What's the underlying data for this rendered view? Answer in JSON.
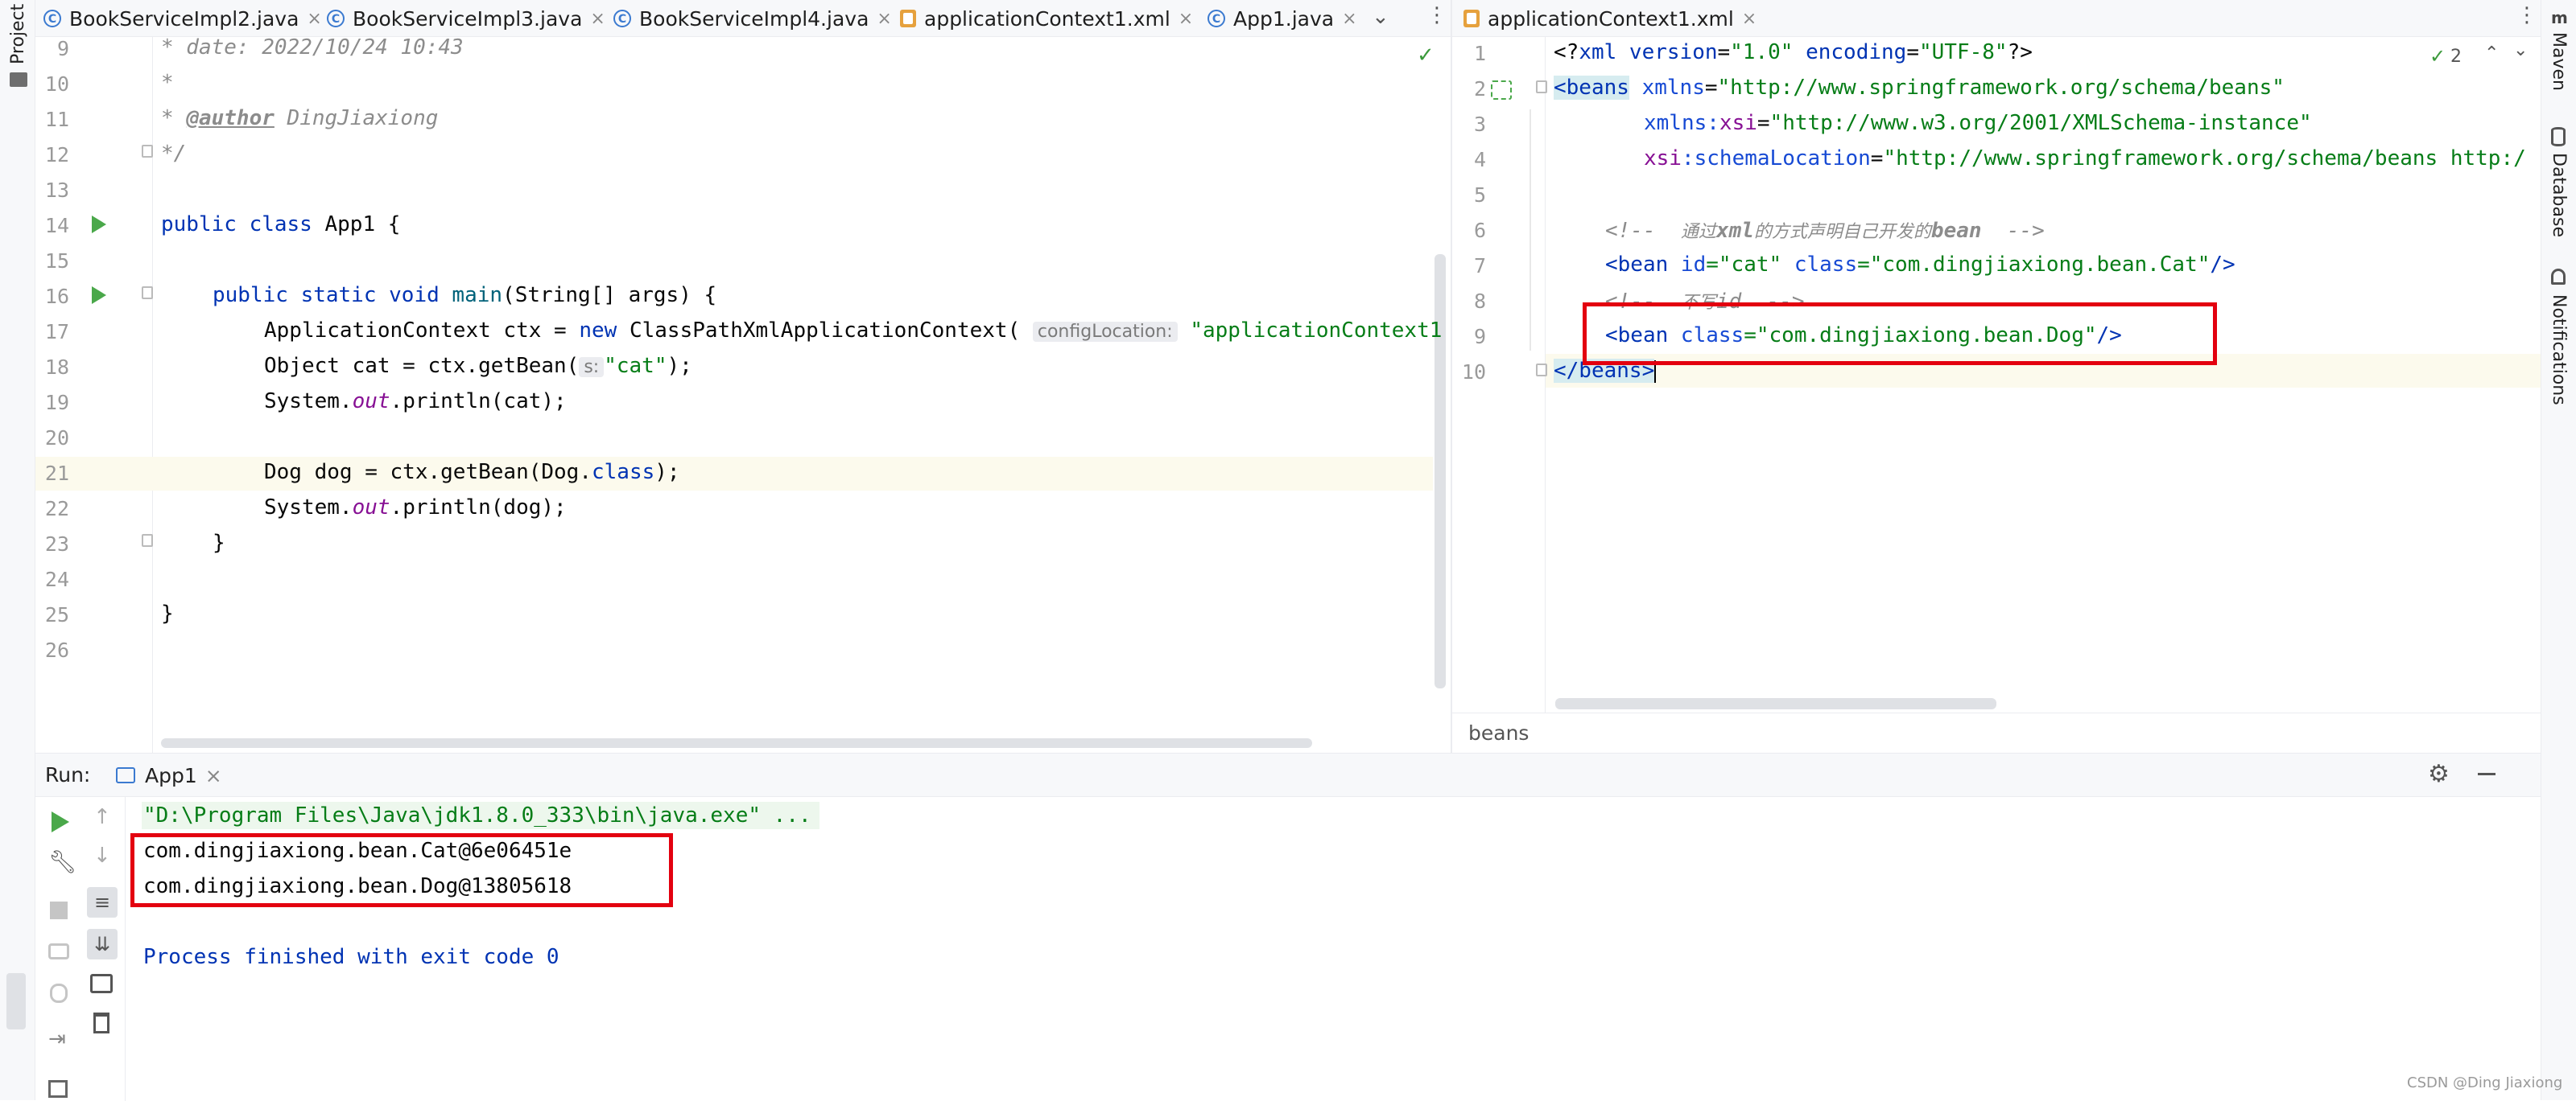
{
  "left_strip": {
    "label": "Project"
  },
  "right_strip": {
    "maven": "Maven",
    "database": "Database",
    "notifications": "Notifications"
  },
  "left_tabs": [
    {
      "label": "BookServiceImpl2.java"
    },
    {
      "label": "BookServiceImpl3.java"
    },
    {
      "label": "BookServiceImpl4.java"
    },
    {
      "label": "applicationContext1.xml"
    },
    {
      "label": "App1.java"
    }
  ],
  "right_tab": {
    "label": "applicationContext1.xml",
    "inspection_count": "2"
  },
  "java_editor": {
    "line_numbers": [
      "9",
      "10",
      "11",
      "12",
      "13",
      "14",
      "15",
      "16",
      "17",
      "18",
      "19",
      "20",
      "21",
      "22",
      "23",
      "24",
      "25",
      "26"
    ],
    "lines": {
      "l9": "* date: 2022/10/24 10:43",
      "l10": "*",
      "l11_prefix": "* ",
      "l11_tag": "@author",
      "l11_name": " DingJiaxiong",
      "l12": "*/",
      "l14_kw": "public class",
      "l14_rest": " App1 {",
      "l16_kw": "public static void",
      "l16_method": " main",
      "l16_rest": "(String[] args) {",
      "l17_a": "ApplicationContext ctx = ",
      "l17_kw": "new",
      "l17_b": " ClassPathXmlApplicationContext(",
      "l17_hint": "configLocation:",
      "l17_str": "\"applicationContext1",
      "l18_a": "Object cat = ctx.getBean(",
      "l18_hint": "s:",
      "l18_str": "\"cat\"",
      "l18_b": ");",
      "l19_a": "System.",
      "l19_out": "out",
      "l19_b": ".println(cat);",
      "l21_a": "Dog dog = ctx.getBean(Dog.",
      "l21_kw": "class",
      "l21_b": ");",
      "l22_a": "System.",
      "l22_out": "out",
      "l22_b": ".println(dog);",
      "l23": "}",
      "l25": "}"
    }
  },
  "xml_editor": {
    "line_numbers": [
      "1",
      "2",
      "3",
      "4",
      "5",
      "6",
      "7",
      "8",
      "9",
      "10"
    ],
    "lines": {
      "x1_a": "<?",
      "x1_b": "xml version",
      "x1_c": "=",
      "x1_d": "\"1.0\"",
      "x1_e": " encoding",
      "x1_f": "=",
      "x1_g": "\"UTF-8\"",
      "x1_h": "?>",
      "x2_tag": "<beans",
      "x2_attr": " xmlns",
      "x2_eq": "=",
      "x2_val": "\"http://www.springframework.org/schema/beans\"",
      "x3_attr": "xmlns:",
      "x3_ns": "xsi",
      "x3_eq": "=",
      "x3_val": "\"http://www.w3.org/2001/XMLSchema-instance\"",
      "x4_ns": "xsi",
      "x4_attr": ":schemaLocation",
      "x4_eq": "=",
      "x4_val": "\"http://www.springframework.org/schema/beans http:/",
      "x6_a": "<!--  ",
      "x6_cn1": "通过",
      "x6_b": "xml",
      "x6_cn2": "的方式声明自己开发的",
      "x6_c": "bean",
      "x6_d": "  -->",
      "x7_tag": "<bean",
      "x7_attr1": " id",
      "x7_val1": "=\"cat\"",
      "x7_attr2": " class",
      "x7_val2": "=\"com.dingjiaxiong.bean.Cat\"",
      "x7_end": "/>",
      "x8_a": "<!--  ",
      "x8_cn": "不写",
      "x8_b": "id  -->",
      "x9_tag": "<bean",
      "x9_attr": " class",
      "x9_val": "=\"com.dingjiaxiong.bean.Dog\"",
      "x9_end": "/>",
      "x10": "</beans>"
    },
    "breadcrumb": "beans"
  },
  "run_panel": {
    "label": "Run:",
    "tab": "App1",
    "command": "\"D:\\Program Files\\Java\\jdk1.8.0_333\\bin\\java.exe\" ...",
    "output": [
      "com.dingjiaxiong.bean.Cat@6e06451e",
      "com.dingjiaxiong.bean.Dog@13805618"
    ],
    "exit": "Process finished with exit code 0"
  },
  "watermark": "CSDN @Ding Jiaxiong",
  "colors": {
    "highlight_box": "#e3000f",
    "accent": "#3574f0"
  }
}
